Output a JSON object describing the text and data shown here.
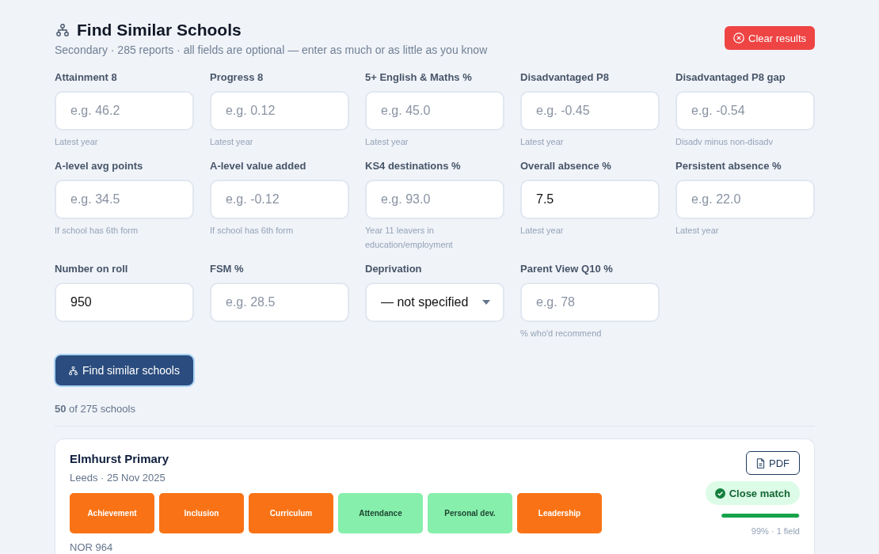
{
  "header": {
    "title": "Find Similar Schools",
    "subtitle": "Secondary · 285 reports · all fields are optional — enter as much or as little as you know",
    "clear_button": "Clear results"
  },
  "fields": [
    {
      "kind": "input",
      "label": "Attainment 8",
      "placeholder": "e.g. 46.2",
      "hint": "Latest year"
    },
    {
      "kind": "input",
      "label": "Progress 8",
      "placeholder": "e.g. 0.12",
      "hint": "Latest year"
    },
    {
      "kind": "input",
      "label": "5+ English & Maths %",
      "placeholder": "e.g. 45.0",
      "hint": "Latest year"
    },
    {
      "kind": "input",
      "label": "Disadvantaged P8",
      "placeholder": "e.g. -0.45",
      "hint": "Latest year"
    },
    {
      "kind": "input",
      "label": "Disadvantaged P8 gap",
      "placeholder": "e.g. -0.54",
      "hint": "Disadv minus non-disadv"
    },
    {
      "kind": "input",
      "label": "A-level avg points",
      "placeholder": "e.g. 34.5",
      "hint": "If school has 6th form"
    },
    {
      "kind": "input",
      "label": "A-level value added",
      "placeholder": "e.g. -0.12",
      "hint": "If school has 6th form"
    },
    {
      "kind": "input",
      "label": "KS4 destinations %",
      "placeholder": "e.g. 93.0",
      "hint": "Year 11 leavers in education/employment"
    },
    {
      "kind": "input",
      "label": "Overall absence %",
      "value": "7.5",
      "hint": "Latest year"
    },
    {
      "kind": "input",
      "label": "Persistent absence %",
      "placeholder": "e.g. 22.0",
      "hint": "Latest year"
    },
    {
      "kind": "input",
      "label": "Number on roll",
      "value": "950"
    },
    {
      "kind": "input",
      "label": "FSM %",
      "placeholder": "e.g. 28.5"
    },
    {
      "kind": "select",
      "label": "Deprivation",
      "value": "— not specified"
    },
    {
      "kind": "input",
      "label": "Parent View Q10 %",
      "placeholder": "e.g. 78",
      "hint": "% who'd recommend"
    }
  ],
  "search_button": "Find similar schools",
  "result_count": "**50** of 275 schools",
  "results": [
    {
      "name": "Elmhurst Primary",
      "meta": "Leeds · 25 Nov 2025",
      "ratings": [
        {
          "label": "Achievement",
          "color": "#f97316"
        },
        {
          "label": "Inclusion",
          "color": "#f97316"
        },
        {
          "label": "Curriculum",
          "color": "#f97316"
        },
        {
          "label": "Attendance",
          "color": "#86efac"
        },
        {
          "label": "Personal dev.",
          "color": "#86efac"
        },
        {
          "label": "Leadership",
          "color": "#f97316"
        }
      ],
      "nor": "NOR 964",
      "pdf_button": "PDF",
      "match": {
        "label": "Close match",
        "level": 0.99,
        "caption": "99% · 1 field"
      }
    }
  ]
}
